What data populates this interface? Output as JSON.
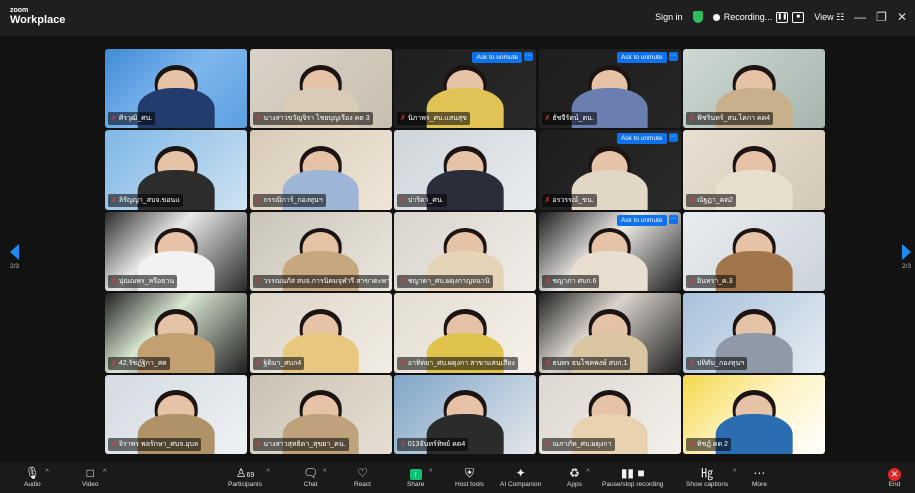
{
  "app": {
    "logo_line1": "zoom",
    "logo_line2": "Workplace"
  },
  "topbar": {
    "sign_in": "Sign in",
    "recording": "Recording...",
    "view": "View"
  },
  "pager": {
    "page": "2/3"
  },
  "tiles": [
    {
      "name": "ศิรวุฒิ_ศน.",
      "unmute": false
    },
    {
      "name": "นางสาวขวัญจิรา ไชยบุญเรือง คต 3",
      "unmute": false
    },
    {
      "name": "นิภาพร_ศบ.แสนสุข",
      "unmute": true
    },
    {
      "name": "ธัชจีรัตน์_ตน.",
      "unmute": true
    },
    {
      "name": "ฟัชรินทร์_สน.โคกา คต4",
      "unmute": false
    },
    {
      "name": "ลิรัญญา_สบจ.ขอนแ",
      "unmute": false
    },
    {
      "name": "กรรณิการ์_กองทุนฯ",
      "unmute": false
    },
    {
      "name": "ปาริดา_ศน.",
      "unmute": false
    },
    {
      "name": "อรวรรณ์_ขน.",
      "unmute": true
    },
    {
      "name": "ณัฐฏา_คต2",
      "unmute": false
    },
    {
      "name": "ปุณณพร_หรือธาน",
      "unmute": false
    },
    {
      "name": "วรรณนภัส สบจ.การนิคมจุฬารี สาขาตะพานหิน",
      "unmute": false
    },
    {
      "name": "ชญาดา_ศบ.ผดุงกาญจนานิ",
      "unmute": false
    },
    {
      "name": "ชญาภา ศบก.6",
      "unmute": true
    },
    {
      "name": "อินทรา_ค.3",
      "unmute": false
    },
    {
      "name": "42.รัชฎ์ฐิกา_สค",
      "unmute": false
    },
    {
      "name": "ฐิติมา_ศบก4",
      "unmute": false
    },
    {
      "name": "อาทิตยา_ศบ.ผดุงกา สาขาแสนเสียง",
      "unmute": false
    },
    {
      "name": "ธนพร ธนโชคพงษ์ สบก.1",
      "unmute": false
    },
    {
      "name": "ปทิตัม_กองทุนฯ",
      "unmute": false
    },
    {
      "name": "จิราพร พลรักษา_ศบจ.อุบล",
      "unmute": false
    },
    {
      "name": "นางสาวสุทธิดา_สุขยา_คน.",
      "unmute": false
    },
    {
      "name": "013จันทร์ทิพย์ คต4",
      "unmute": false
    },
    {
      "name": "ณภาภัท_ศบ.ผดุงกา",
      "unmute": false
    },
    {
      "name": "ทิชฎ์ คต 2",
      "unmute": false
    }
  ],
  "overlays": {
    "ask_unmute": "Ask to unmute",
    "more": "···"
  },
  "toolbar": {
    "audio": "Audio",
    "video": "Video",
    "participants": "Participants",
    "participants_count": "69",
    "chat": "Chat",
    "react": "React",
    "share": "Share",
    "host_tools": "Host tools",
    "ai_companion": "AI Companion",
    "apps": "Apps",
    "pause_recording": "Pause/stop recording",
    "show_captions": "Show captions",
    "more": "More",
    "end": "End"
  },
  "colors": {
    "accent": "#0e72ed",
    "end": "#e02828",
    "share": "#0cc079",
    "mic_muted": "#e5363c"
  }
}
